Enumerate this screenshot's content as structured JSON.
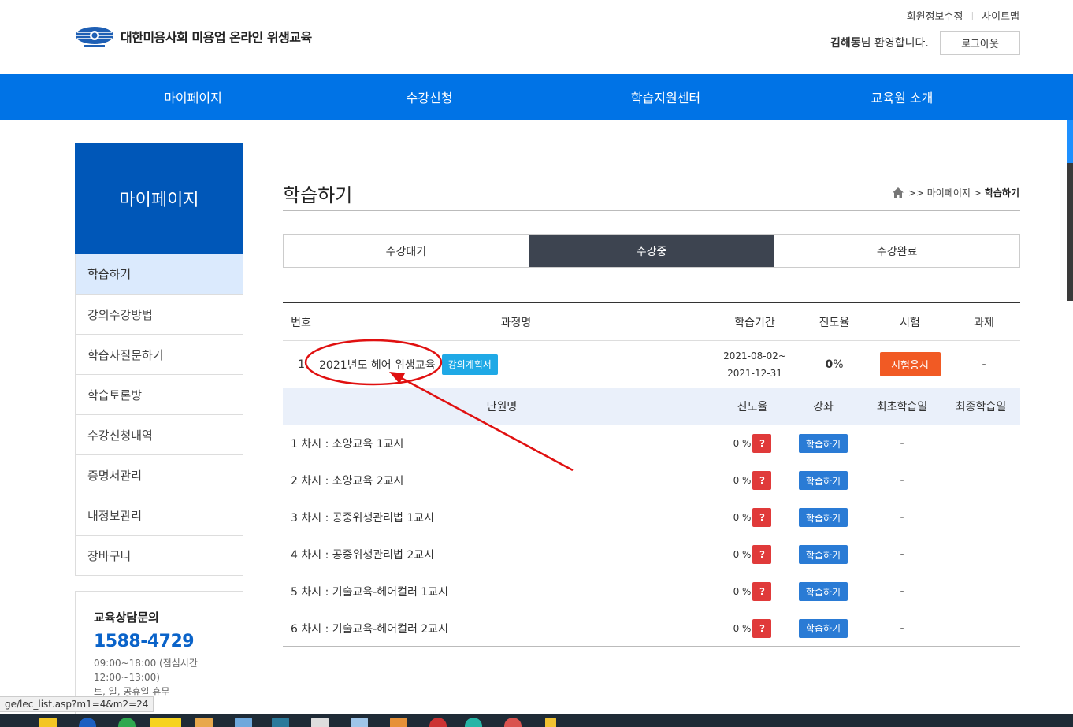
{
  "header": {
    "logo_text": "대한미용사회 미용업 온라인 위생교육",
    "util_links": [
      "회원정보수정",
      "사이트맵"
    ],
    "user_name": "김해동",
    "greeting_suffix": "님 환영합니다.",
    "logout_label": "로그아웃"
  },
  "nav": {
    "items": [
      "마이페이지",
      "수강신청",
      "학습지원센터",
      "교육원 소개"
    ]
  },
  "sidebar": {
    "title": "마이페이지",
    "items": [
      "학습하기",
      "강의수강방법",
      "학습자질문하기",
      "학습토론방",
      "수강신청내역",
      "증명서관리",
      "내정보관리",
      "장바구니"
    ],
    "active_index": 0
  },
  "contact": {
    "title": "교육상담문의",
    "phone": "1588-4729",
    "hours_line1": "09:00~18:00 (점심시간",
    "hours_line2": "12:00~13:00)",
    "hours_line3": "토, 일, 공휴일 휴무"
  },
  "content": {
    "page_title": "학습하기",
    "breadcrumb": {
      "sep": ">>",
      "parent": "마이페이지",
      "arrow": ">",
      "current": "학습하기"
    },
    "tabs": [
      "수강대기",
      "수강중",
      "수강완료"
    ],
    "active_tab": 1,
    "table_headers": [
      "번호",
      "과정명",
      "학습기간",
      "진도율",
      "시험",
      "과제"
    ],
    "course": {
      "no": "1",
      "name": "2021년도 헤어 위생교육",
      "plan_label": "강의계획서",
      "period_start": "2021-08-02~",
      "period_end": "2021-12-31",
      "progress_value": "0",
      "progress_unit": " %",
      "exam_label": "시험응시",
      "assignment": "-"
    },
    "unit_headers": [
      "단원명",
      "진도율",
      "강좌",
      "최초학습일",
      "최종학습일"
    ],
    "units": [
      {
        "name": "1 차시 : 소양교육 1교시",
        "progress": "0 %",
        "badge": "?",
        "action": "학습하기",
        "first": "-",
        "last": ""
      },
      {
        "name": "2 차시 : 소양교육 2교시",
        "progress": "0 %",
        "badge": "?",
        "action": "학습하기",
        "first": "-",
        "last": ""
      },
      {
        "name": "3 차시 : 공중위생관리법 1교시",
        "progress": "0 %",
        "badge": "?",
        "action": "학습하기",
        "first": "-",
        "last": ""
      },
      {
        "name": "4 차시 : 공중위생관리법 2교시",
        "progress": "0 %",
        "badge": "?",
        "action": "학습하기",
        "first": "-",
        "last": ""
      },
      {
        "name": "5 차시 : 기술교육-헤어컬러 1교시",
        "progress": "0 %",
        "badge": "?",
        "action": "학습하기",
        "first": "-",
        "last": ""
      },
      {
        "name": "6 차시 : 기술교육-헤어컬러 2교시",
        "progress": "0 %",
        "badge": "?",
        "action": "학습하기",
        "first": "-",
        "last": ""
      }
    ]
  },
  "status_url": "ge/lec_list.asp?m1=4&m2=24",
  "colors": {
    "nav_blue": "#0073e6",
    "sidebar_title": "#0057b8",
    "active_tab": "#3d4450",
    "exam_button": "#f15a24",
    "study_button": "#2a7bd5",
    "plan_button": "#1fa9e6",
    "question_badge": "#e03a3a",
    "annotation_red": "#e01010"
  }
}
